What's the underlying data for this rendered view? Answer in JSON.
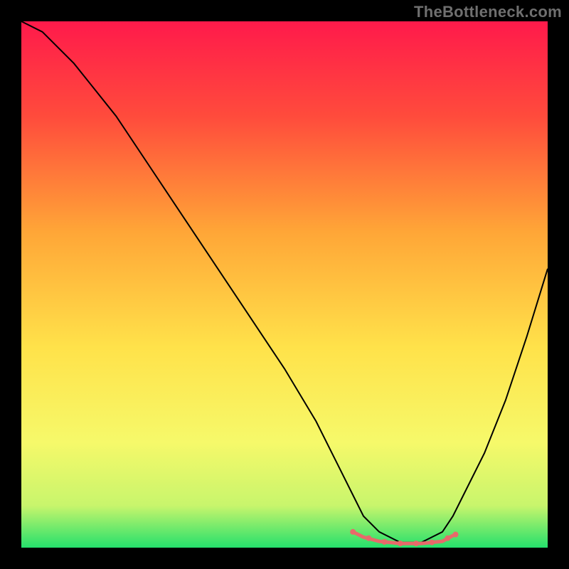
{
  "watermark": "TheBottleneck.com",
  "chart_data": {
    "type": "line",
    "title": "",
    "xlabel": "",
    "ylabel": "",
    "xlim": [
      0,
      100
    ],
    "ylim": [
      0,
      100
    ],
    "grid": false,
    "axes_visible": false,
    "background": {
      "stops": [
        {
          "offset": 0,
          "color": "#ff1a4b"
        },
        {
          "offset": 18,
          "color": "#ff4b3c"
        },
        {
          "offset": 40,
          "color": "#ffa637"
        },
        {
          "offset": 62,
          "color": "#ffe24a"
        },
        {
          "offset": 80,
          "color": "#f6f96a"
        },
        {
          "offset": 92,
          "color": "#c8f56c"
        },
        {
          "offset": 100,
          "color": "#25e06c"
        }
      ]
    },
    "series": [
      {
        "name": "bottleneck-curve",
        "color": "#000000",
        "width": 2,
        "x": [
          0,
          4,
          10,
          18,
          26,
          34,
          42,
          50,
          56,
          60,
          63,
          65,
          68,
          72,
          76,
          80,
          82,
          84,
          88,
          92,
          96,
          100
        ],
        "values": [
          100,
          98,
          92,
          82,
          70,
          58,
          46,
          34,
          24,
          16,
          10,
          6,
          3,
          1,
          1,
          3,
          6,
          10,
          18,
          28,
          40,
          53
        ]
      },
      {
        "name": "optimal-range-marker",
        "color": "#e76a6a",
        "width": 5,
        "x": [
          63,
          65,
          68,
          72,
          76,
          80,
          82
        ],
        "values": [
          3,
          2,
          1.2,
          0.8,
          0.8,
          1.2,
          2.3
        ]
      }
    ],
    "marker_dots": {
      "color": "#e76a6a",
      "radius": 4,
      "x": [
        63,
        66,
        69,
        72,
        75,
        78,
        81,
        82.5
      ],
      "values": [
        3,
        1.8,
        1.1,
        0.8,
        0.8,
        1.0,
        1.8,
        2.5
      ]
    }
  }
}
